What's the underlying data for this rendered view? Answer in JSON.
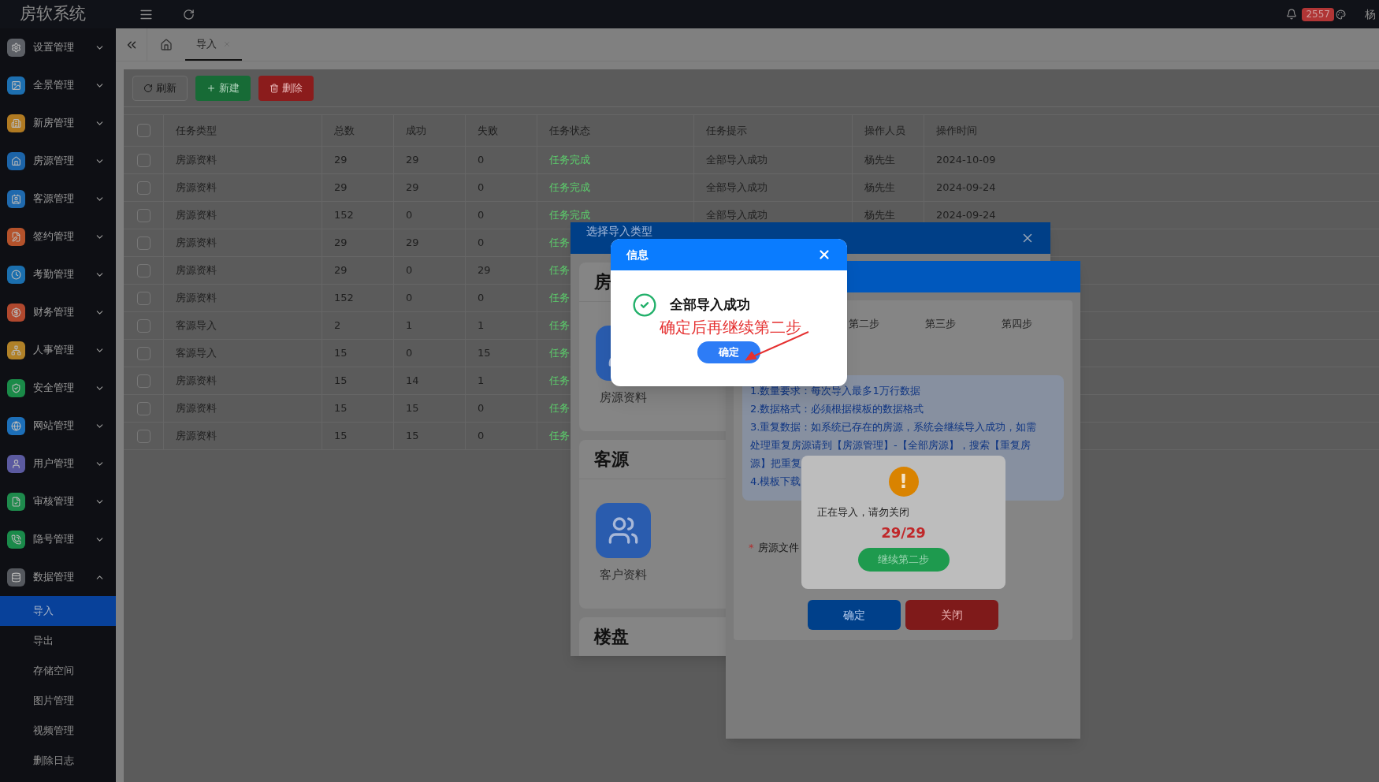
{
  "app": {
    "logo": "房软系统"
  },
  "topbar": {
    "badge": "2557",
    "user": "杨"
  },
  "sidebar": {
    "items": [
      {
        "label": "设置管理",
        "color": "#5d6066",
        "expanded": false
      },
      {
        "label": "全景管理",
        "color": "#1d6fb0",
        "expanded": false
      },
      {
        "label": "新房管理",
        "color": "#b07a22",
        "expanded": false
      },
      {
        "label": "房源管理",
        "color": "#1c64a8",
        "expanded": false
      },
      {
        "label": "客源管理",
        "color": "#1f69ad",
        "expanded": false
      },
      {
        "label": "签约管理",
        "color": "#b4522b",
        "expanded": false
      },
      {
        "label": "考勤管理",
        "color": "#1b6fae",
        "expanded": false
      },
      {
        "label": "财务管理",
        "color": "#b0482e",
        "expanded": false
      },
      {
        "label": "人事管理",
        "color": "#b08128",
        "expanded": false
      },
      {
        "label": "安全管理",
        "color": "#1a8a48",
        "expanded": false
      },
      {
        "label": "网站管理",
        "color": "#1d6fb8",
        "expanded": false
      },
      {
        "label": "用户管理",
        "color": "#5b5aa0",
        "expanded": false
      },
      {
        "label": "审核管理",
        "color": "#1e8a4c",
        "expanded": false
      },
      {
        "label": "隐号管理",
        "color": "#1a8a4a",
        "expanded": false
      },
      {
        "label": "数据管理",
        "color": "#55585e",
        "expanded": true,
        "children": [
          {
            "label": "导入",
            "selected": true
          },
          {
            "label": "导出",
            "selected": false
          },
          {
            "label": "存储空间",
            "selected": false
          },
          {
            "label": "图片管理",
            "selected": false
          },
          {
            "label": "视频管理",
            "selected": false
          },
          {
            "label": "删除日志",
            "selected": false
          }
        ]
      }
    ]
  },
  "tabs": [
    {
      "label": "导入",
      "selected": true
    }
  ],
  "toolbar": [
    {
      "label": "刷新",
      "kind": "refresh"
    },
    {
      "label": "新建",
      "kind": "create"
    },
    {
      "label": "删除",
      "kind": "delete"
    }
  ],
  "table": {
    "all_checked": false,
    "columns": [
      "任务类型",
      "总数",
      "成功",
      "失败",
      "任务状态",
      "任务提示",
      "操作人员",
      "操作时间"
    ],
    "rows": [
      {
        "checked": false,
        "cells": [
          "房源资料",
          "29",
          "29",
          "0",
          "任务完成",
          "全部导入成功",
          "杨先生",
          "2024-10-09"
        ]
      },
      {
        "checked": false,
        "cells": [
          "房源资料",
          "29",
          "29",
          "0",
          "任务完成",
          "全部导入成功",
          "杨先生",
          "2024-09-24"
        ]
      },
      {
        "checked": false,
        "cells": [
          "房源资料",
          "152",
          "0",
          "0",
          "任务完成",
          "全部导入成功",
          "杨先生",
          "2024-09-24"
        ]
      },
      {
        "checked": false,
        "cells": [
          "房源资料",
          "29",
          "29",
          "0",
          "任务"
        ]
      },
      {
        "checked": false,
        "cells": [
          "房源资料",
          "29",
          "0",
          "29",
          "任务"
        ]
      },
      {
        "checked": false,
        "cells": [
          "房源资料",
          "152",
          "0",
          "0",
          "任务"
        ]
      },
      {
        "checked": false,
        "cells": [
          "客源导入",
          "2",
          "1",
          "1",
          "任务"
        ]
      },
      {
        "checked": false,
        "cells": [
          "客源导入",
          "15",
          "0",
          "15",
          "任务"
        ]
      },
      {
        "checked": false,
        "cells": [
          "房源资料",
          "15",
          "14",
          "1",
          "任务"
        ]
      },
      {
        "checked": false,
        "cells": [
          "房源资料",
          "15",
          "15",
          "0",
          "任务"
        ]
      },
      {
        "checked": false,
        "cells": [
          "房源资料",
          "15",
          "15",
          "0",
          "任务"
        ]
      }
    ]
  },
  "select_dialog": {
    "title": "选择导入类型",
    "sections": [
      {
        "heading": "房",
        "items": [
          "房源资料"
        ]
      },
      {
        "heading": "客源",
        "items": [
          "客户资料"
        ]
      },
      {
        "heading": "楼盘"
      }
    ]
  },
  "wizard_dialog": {
    "steps": [
      "第二步",
      "第三步",
      "第四步"
    ],
    "notes": [
      "1.数量要求：每次导入最多1万行数据",
      "2.数据格式：必须根据模板的数据格式",
      "3.重复数据：如系统已存在的房源，系统会继续导入成功，如需",
      "处理重复房源请到【房源管理】-【全部房源】，搜索【重复房",
      "源】把重复",
      "4.模板下载"
    ],
    "file_label": {
      "mark": "*",
      "text": "房源文件"
    },
    "buttons": [
      {
        "label": "确定",
        "kind": "primary"
      },
      {
        "label": "关闭",
        "kind": "danger"
      }
    ]
  },
  "progress": {
    "icon": "!",
    "message": "正在导入，请勿关闭",
    "count": "29/29",
    "button": "继续第二步"
  },
  "message_box": {
    "title": "信息",
    "message": "全部导入成功",
    "annotation": "确定后再继续第二步",
    "button": "确定"
  }
}
